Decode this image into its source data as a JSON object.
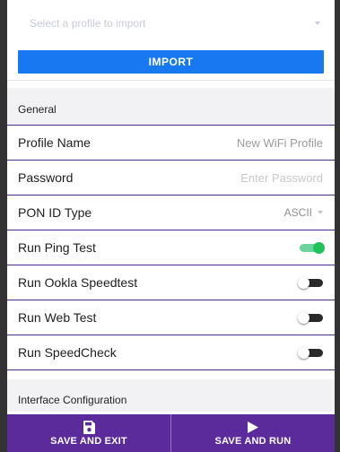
{
  "import": {
    "placeholder": "Select a profile to import",
    "button_label": "IMPORT"
  },
  "general": {
    "header": "General",
    "rows": [
      {
        "label": "Profile Name",
        "value": "New WiFi Profile"
      },
      {
        "label": "Password",
        "placeholder": "Enter Password"
      },
      {
        "label": "PON ID Type",
        "value": "ASCII"
      },
      {
        "label": "Run Ping Test",
        "on": true
      },
      {
        "label": "Run Ookla Speedtest",
        "on": false
      },
      {
        "label": "Run Web Test",
        "on": false
      },
      {
        "label": "Run SpeedCheck",
        "on": false
      }
    ]
  },
  "interface": {
    "header": "Interface Configuration"
  },
  "bottom_bar": {
    "save_exit_label": "SAVE AND EXIT",
    "save_run_label": "SAVE AND RUN"
  },
  "colors": {
    "accent_blue": "#1778f2",
    "bar_purple": "#5b2b9c",
    "toggle_on": "#1fc35c",
    "divider": "#4a2a8f"
  },
  "icons": {
    "save_exit": "save-icon",
    "save_run": "play-icon"
  }
}
